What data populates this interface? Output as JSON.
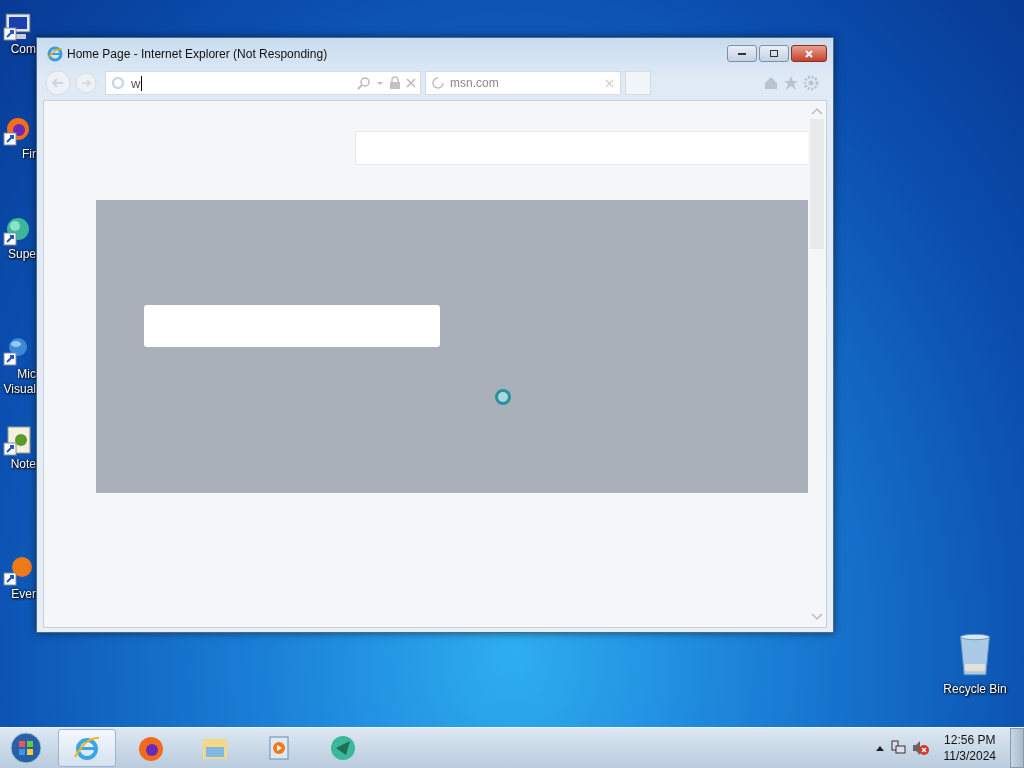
{
  "desktop_icons": [
    {
      "kind": "computer",
      "lines": [
        "Com"
      ]
    },
    {
      "kind": "firefox",
      "lines": [
        "Fir"
      ]
    },
    {
      "kind": "globe",
      "lines": [
        "Supe"
      ]
    },
    {
      "kind": "bluesphere",
      "lines": [
        "Mic",
        "Visual"
      ]
    },
    {
      "kind": "notepad",
      "lines": [
        "Note"
      ]
    },
    {
      "kind": "orange",
      "lines": [
        "Ever"
      ]
    }
  ],
  "recycle_bin": {
    "label": "Recycle Bin"
  },
  "window": {
    "title": "Home Page - Internet Explorer (Not Responding)",
    "address": "w",
    "tabs": [
      {
        "label": "msn.com",
        "selected": true
      }
    ]
  },
  "taskbar": {
    "items": [
      {
        "kind": "ie",
        "selected": true
      },
      {
        "kind": "firefox",
        "selected": false
      },
      {
        "kind": "folder",
        "selected": false
      },
      {
        "kind": "media",
        "selected": false
      },
      {
        "kind": "app",
        "selected": false
      }
    ]
  },
  "tray": {
    "time": "12:56 PM",
    "date": "11/3/2024"
  }
}
